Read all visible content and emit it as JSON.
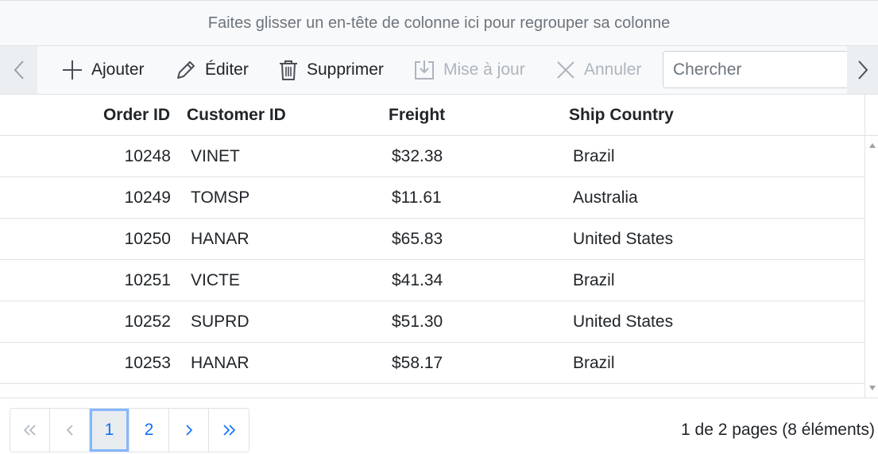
{
  "group_drop_text": "Faites glisser un en-tête de colonne ici pour regrouper sa colonne",
  "toolbar": {
    "nav_left_icon": "chevron-left-icon",
    "nav_right_icon": "chevron-right-icon",
    "items": [
      {
        "label": "Ajouter",
        "icon": "plus-icon",
        "enabled": true
      },
      {
        "label": "Éditer",
        "icon": "pencil-icon",
        "enabled": true
      },
      {
        "label": "Supprimer",
        "icon": "trash-icon",
        "enabled": true
      },
      {
        "label": "Mise à jour",
        "icon": "save-icon",
        "enabled": false
      },
      {
        "label": "Annuler",
        "icon": "close-icon",
        "enabled": false
      }
    ],
    "search_placeholder": "Chercher"
  },
  "grid": {
    "columns": [
      "Order ID",
      "Customer ID",
      "Freight",
      "Ship Country"
    ],
    "rows": [
      [
        "10248",
        "VINET",
        "$32.38",
        "Brazil"
      ],
      [
        "10249",
        "TOMSP",
        "$11.61",
        "Australia"
      ],
      [
        "10250",
        "HANAR",
        "$65.83",
        "United States"
      ],
      [
        "10251",
        "VICTE",
        "$41.34",
        "Brazil"
      ],
      [
        "10252",
        "SUPRD",
        "$51.30",
        "United States"
      ],
      [
        "10253",
        "HANAR",
        "$58.17",
        "Brazil"
      ]
    ]
  },
  "pager": {
    "first_icon": "double-chevron-left-icon",
    "prev_icon": "chevron-left-icon",
    "pages": [
      "1",
      "2"
    ],
    "current_page": "1",
    "next_icon": "chevron-right-icon",
    "last_icon": "double-chevron-right-icon",
    "info": "1 de 2 pages (8 éléments)"
  },
  "colors": {
    "accent": "#0d6efd",
    "active_page_ring": "#86b7fe",
    "toolbar_bg": "#f8f9fa",
    "border": "#dee2e6",
    "disabled": "#adb5bd"
  }
}
